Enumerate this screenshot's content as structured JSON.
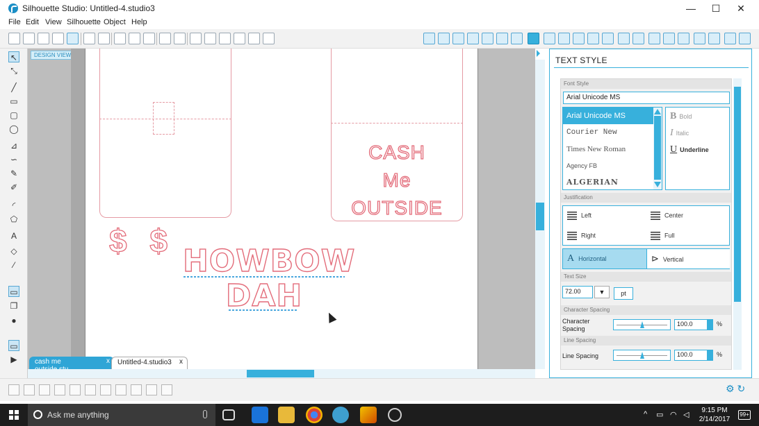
{
  "window": {
    "title": "Silhouette Studio: Untitled-4.studio3",
    "minimize": "—",
    "maximize": "☐",
    "close": "✕"
  },
  "menu": [
    "File",
    "Edit",
    "View",
    "Silhouette",
    "Object",
    "Help"
  ],
  "canvas": {
    "badge": "DESIGN VIEW",
    "cash_lines": [
      "CASH",
      "Me",
      "OUTSIDE"
    ],
    "dollars": "$ $",
    "howbow_lines": [
      "HOWBOW",
      "DAH"
    ]
  },
  "tabs": [
    {
      "label": "cash me outside.stu...",
      "close": "x"
    },
    {
      "label": "Untitled-4.studio3",
      "close": "x"
    }
  ],
  "panel": {
    "title": "TEXT STYLE",
    "font_style_label": "Font Style",
    "font_value": "Arial Unicode MS",
    "fonts": [
      "Arial Unicode MS",
      "Courier New",
      "Times New Roman",
      "Agency FB",
      "ALGERIAN"
    ],
    "styles": [
      {
        "glyph": "B",
        "label": "Bold"
      },
      {
        "glyph": "I",
        "label": "Italic"
      },
      {
        "glyph": "U",
        "label": "Underline"
      }
    ],
    "justification_label": "Justification",
    "justify": [
      "Left",
      "Center",
      "Right",
      "Full"
    ],
    "orientation": [
      "Horizontal",
      "Vertical"
    ],
    "text_size_label": "Text Size",
    "text_size": "72.00",
    "text_size_unit": "pt",
    "char_spacing_section": "Character Spacing",
    "char_spacing_label": "Character Spacing",
    "char_spacing_value": "100.0",
    "line_spacing_section": "Line Spacing",
    "line_spacing_label": "Line Spacing",
    "line_spacing_value": "100.0",
    "percent": "%"
  },
  "taskbar": {
    "search_placeholder": "Ask me anything",
    "time": "9:15 PM",
    "date": "2/14/2017",
    "notifications": "99+"
  },
  "colors": {
    "accent": "#37b0dc",
    "cut_line": "#e36c7a",
    "taskbar": "#1d1d1d"
  }
}
